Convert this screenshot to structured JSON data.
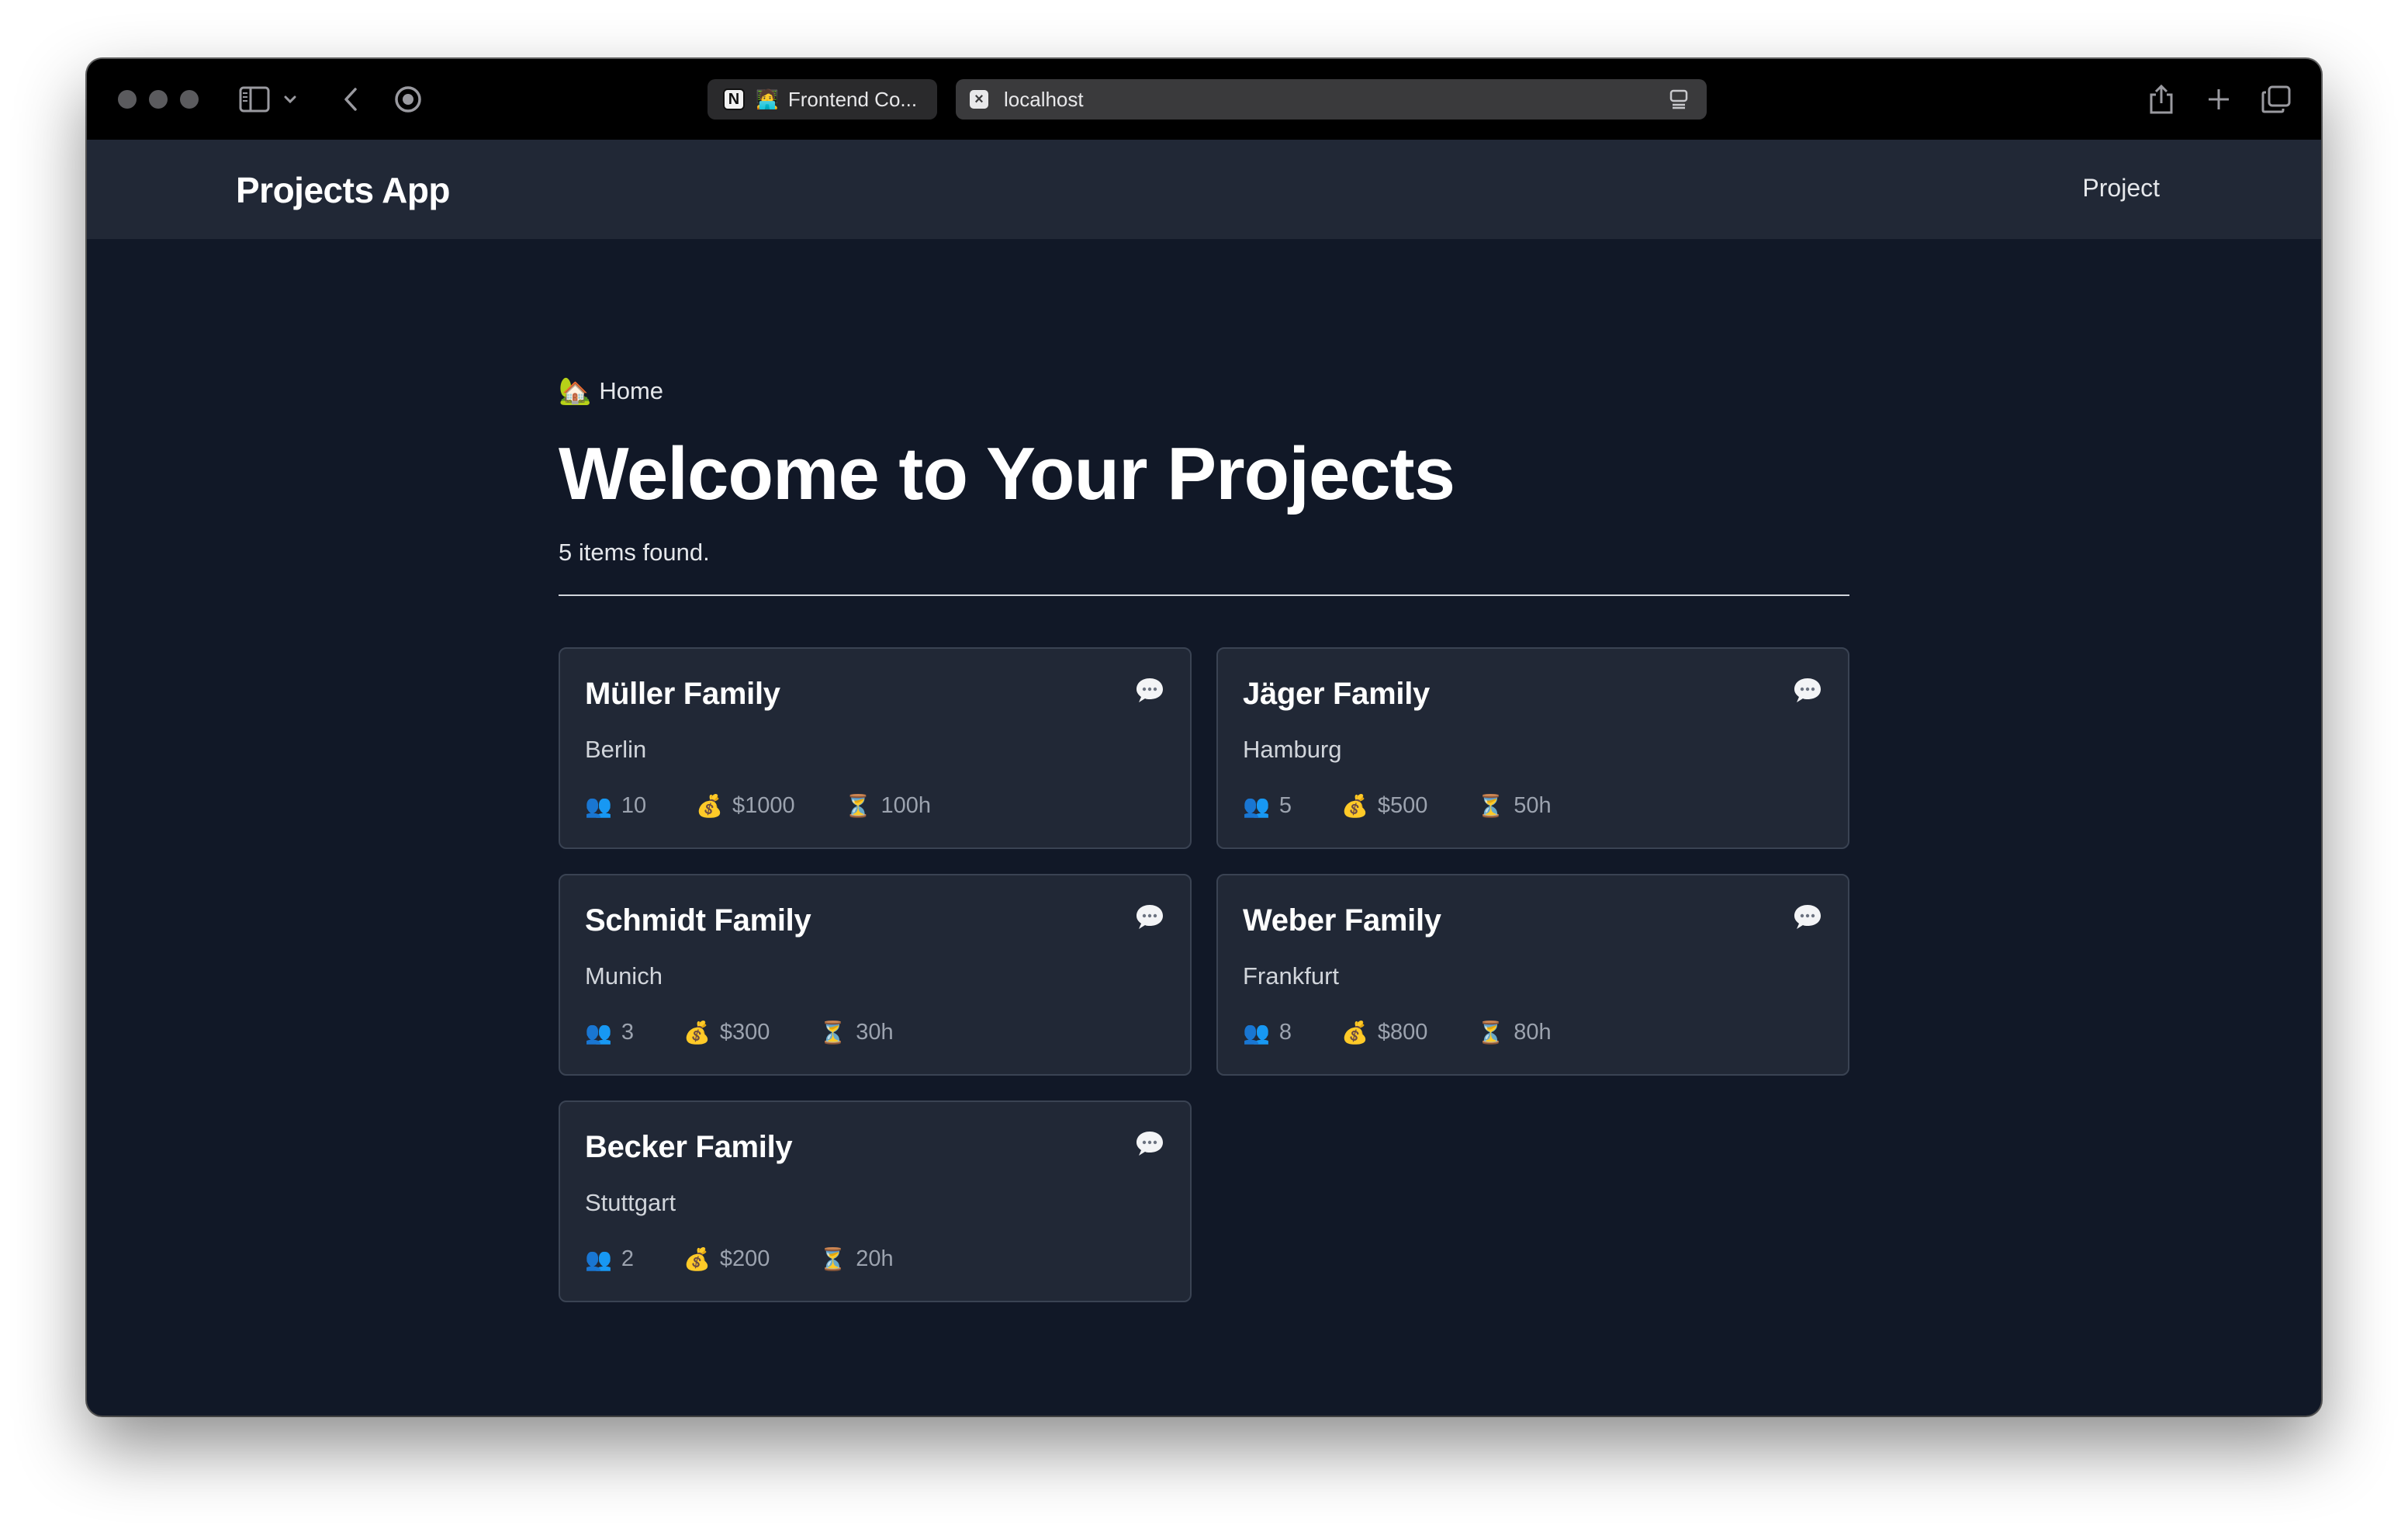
{
  "browser": {
    "tabs": [
      {
        "label": "Frontend Co...",
        "favicon": "notion-icon",
        "emoji": "🧑‍💻"
      },
      {
        "label": "localhost",
        "favicon": "close-icon"
      }
    ]
  },
  "navbar": {
    "brand": "Projects App",
    "link": "Project"
  },
  "breadcrumb": {
    "emoji": "🏡",
    "label": "Home"
  },
  "page": {
    "title": "Welcome to Your Projects",
    "count_text": "5 items found."
  },
  "stat_icons": {
    "people": "👥",
    "money": "💰",
    "time": "⏳"
  },
  "projects": [
    {
      "name": "Müller Family",
      "city": "Berlin",
      "people": "10",
      "budget": "$1000",
      "hours": "100h"
    },
    {
      "name": "Jäger Family",
      "city": "Hamburg",
      "people": "5",
      "budget": "$500",
      "hours": "50h"
    },
    {
      "name": "Schmidt Family",
      "city": "Munich",
      "people": "3",
      "budget": "$300",
      "hours": "30h"
    },
    {
      "name": "Weber Family",
      "city": "Frankfurt",
      "people": "8",
      "budget": "$800",
      "hours": "80h"
    },
    {
      "name": "Becker Family",
      "city": "Stuttgart",
      "people": "2",
      "budget": "$200",
      "hours": "20h"
    }
  ],
  "colors": {
    "page_bg": "#111827",
    "navbar_bg": "#212836",
    "card_bg": "#212836",
    "card_border": "#3a4353"
  }
}
